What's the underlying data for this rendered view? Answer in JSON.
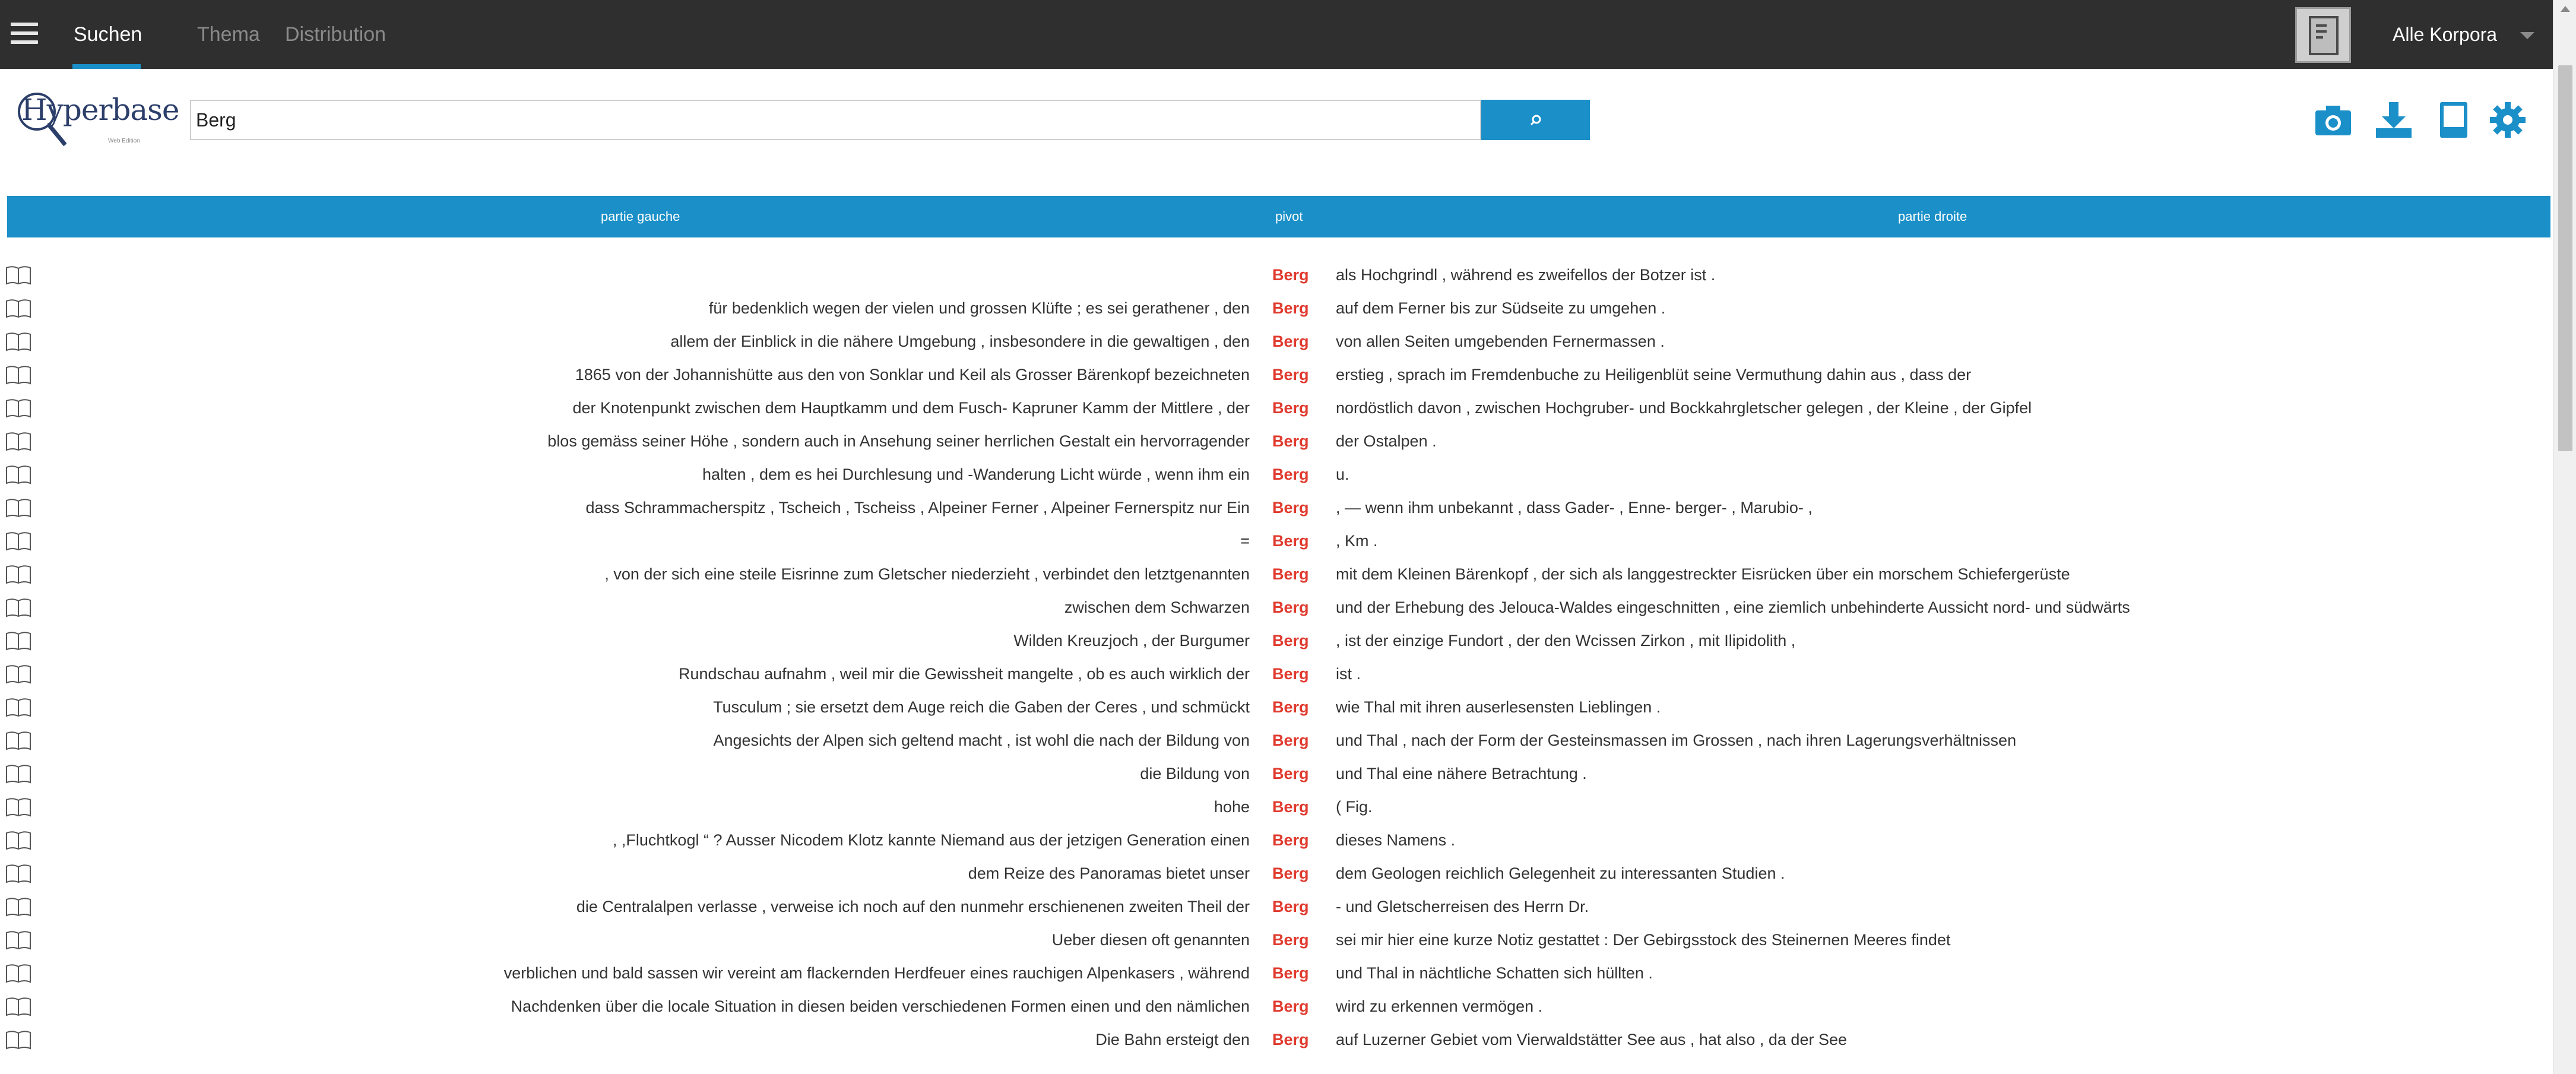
{
  "nav": {
    "tabs": [
      {
        "label": "Suchen",
        "active": true
      },
      {
        "label": "Thema",
        "active": false
      },
      {
        "label": "Distribution",
        "active": false
      }
    ],
    "corpus_label": "Alle Korpora"
  },
  "logo": {
    "text": "Hyperbase",
    "subtitle": "Web Edition"
  },
  "search": {
    "value": "Berg",
    "button_icon": "search-icon"
  },
  "toolbar": {
    "icons": [
      "camera-icon",
      "download-icon",
      "book-icon",
      "gear-icon"
    ]
  },
  "colors": {
    "accent": "#1a8fc8",
    "pivot": "#e03a2e",
    "nav_bg": "#2f2f2f"
  },
  "table": {
    "headers": {
      "left": "partie gauche",
      "pivot": "pivot",
      "right": "partie droite"
    },
    "rows": [
      {
        "left": "",
        "pivot": "Berg",
        "right": "als Hochgrindl , während es zweifellos der Botzer ist ."
      },
      {
        "left": "für bedenklich wegen der vielen und grossen Klüfte ; es sei gerathener , den",
        "pivot": "Berg",
        "right": "auf dem Ferner bis zur Südseite zu umgehen ."
      },
      {
        "left": "allem der Einblick in die nähere Umgebung , insbesondere in die gewaltigen , den",
        "pivot": "Berg",
        "right": "von allen Seiten umgebenden Fernermassen ."
      },
      {
        "left": "1865 von der Johannishütte aus den von Sonklar und Keil als Grosser Bärenkopf bezeichneten",
        "pivot": "Berg",
        "right": "erstieg , sprach im Fremdenbuche zu Heiligenblüt seine Vermuthung dahin aus , dass der"
      },
      {
        "left": "der Knotenpunkt zwischen dem Hauptkamm und dem Fusch- Kapruner Kamm der Mittlere , der",
        "pivot": "Berg",
        "right": "nordöstlich davon , zwischen Hochgruber- und Bockkahrgletscher gelegen , der Kleine , der Gipfel"
      },
      {
        "left": "blos gemäss seiner Höhe , sondern auch in Ansehung seiner herrlichen Gestalt ein hervorragender",
        "pivot": "Berg",
        "right": "der Ostalpen ."
      },
      {
        "left": "halten , dem es hei Durchlesung und -Wanderung Licht würde , wenn ihm ein",
        "pivot": "Berg",
        "right": "u."
      },
      {
        "left": "dass Schrammacherspitz , Tscheich , Tscheiss , Alpeiner Ferner , Alpeiner Fernerspitz nur Ein",
        "pivot": "Berg",
        "right": ", — wenn ihm unbekannt , dass Gader- , Enne- berger- , Marubio- ,"
      },
      {
        "left": "=",
        "pivot": "Berg",
        "right": ", Km ."
      },
      {
        "left": ", von der sich eine steile Eisrinne zum Gletscher niederzieht , verbindet den letztgenannten",
        "pivot": "Berg",
        "right": "mit dem Kleinen Bärenkopf , der sich als langgestreckter Eisrücken über ein morschem Schiefergerüste"
      },
      {
        "left": "zwischen dem Schwarzen",
        "pivot": "Berg",
        "right": "und der Erhebung des Jelouca-Waldes eingeschnitten , eine ziemlich unbehinderte Aussicht nord- und südwärts"
      },
      {
        "left": "Wilden Kreuzjoch , der Burgumer",
        "pivot": "Berg",
        "right": ", ist der einzige Fundort , der den Wcissen Zirkon , mit Ilipidolith ,"
      },
      {
        "left": "Rundschau aufnahm , weil mir die Gewissheit mangelte , ob es auch wirklich der",
        "pivot": "Berg",
        "right": "ist ."
      },
      {
        "left": "Tusculum ; sie ersetzt dem Auge reich die Gaben der Ceres , und schmückt",
        "pivot": "Berg",
        "right": "wie Thal mit ihren auserlesensten Lieblingen ."
      },
      {
        "left": "Angesichts der Alpen sich geltend macht , ist wohl die nach der Bildung von",
        "pivot": "Berg",
        "right": "und Thal , nach der Form der Gesteinsmassen im Grossen , nach ihren Lagerungsverhältnissen"
      },
      {
        "left": "die Bildung von",
        "pivot": "Berg",
        "right": "und Thal eine nähere Betrachtung ."
      },
      {
        "left": "hohe",
        "pivot": "Berg",
        "right": "( Fig."
      },
      {
        "left": ", ,Fluchtkogl “ ? Ausser Nicodem Klotz kannte Niemand aus der jetzigen Generation einen",
        "pivot": "Berg",
        "right": "dieses Namens ."
      },
      {
        "left": "dem Reize des Panoramas bietet unser",
        "pivot": "Berg",
        "right": "dem Geologen reichlich Gelegenheit zu interessanten Studien ."
      },
      {
        "left": "die Centralalpen verlasse , verweise ich noch auf den nunmehr erschienenen zweiten Theil der",
        "pivot": "Berg",
        "right": "- und Gletscherreisen des Herrn Dr."
      },
      {
        "left": "Ueber diesen oft genannten",
        "pivot": "Berg",
        "right": "sei mir hier eine kurze Notiz gestattet : Der Gebirgsstock des Steinernen Meeres findet"
      },
      {
        "left": "verblichen und bald sassen wir vereint am flackernden Herdfeuer eines rauchigen Alpenkasers , während",
        "pivot": "Berg",
        "right": "und Thal in nächtliche Schatten sich hüllten ."
      },
      {
        "left": "Nachdenken über die locale Situation in diesen beiden verschiedenen Formen einen und den nämlichen",
        "pivot": "Berg",
        "right": "wird zu erkennen vermögen ."
      },
      {
        "left": "Die Bahn ersteigt den",
        "pivot": "Berg",
        "right": "auf Luzerner Gebiet vom Vierwaldstätter See aus , hat also , da der See"
      }
    ]
  }
}
